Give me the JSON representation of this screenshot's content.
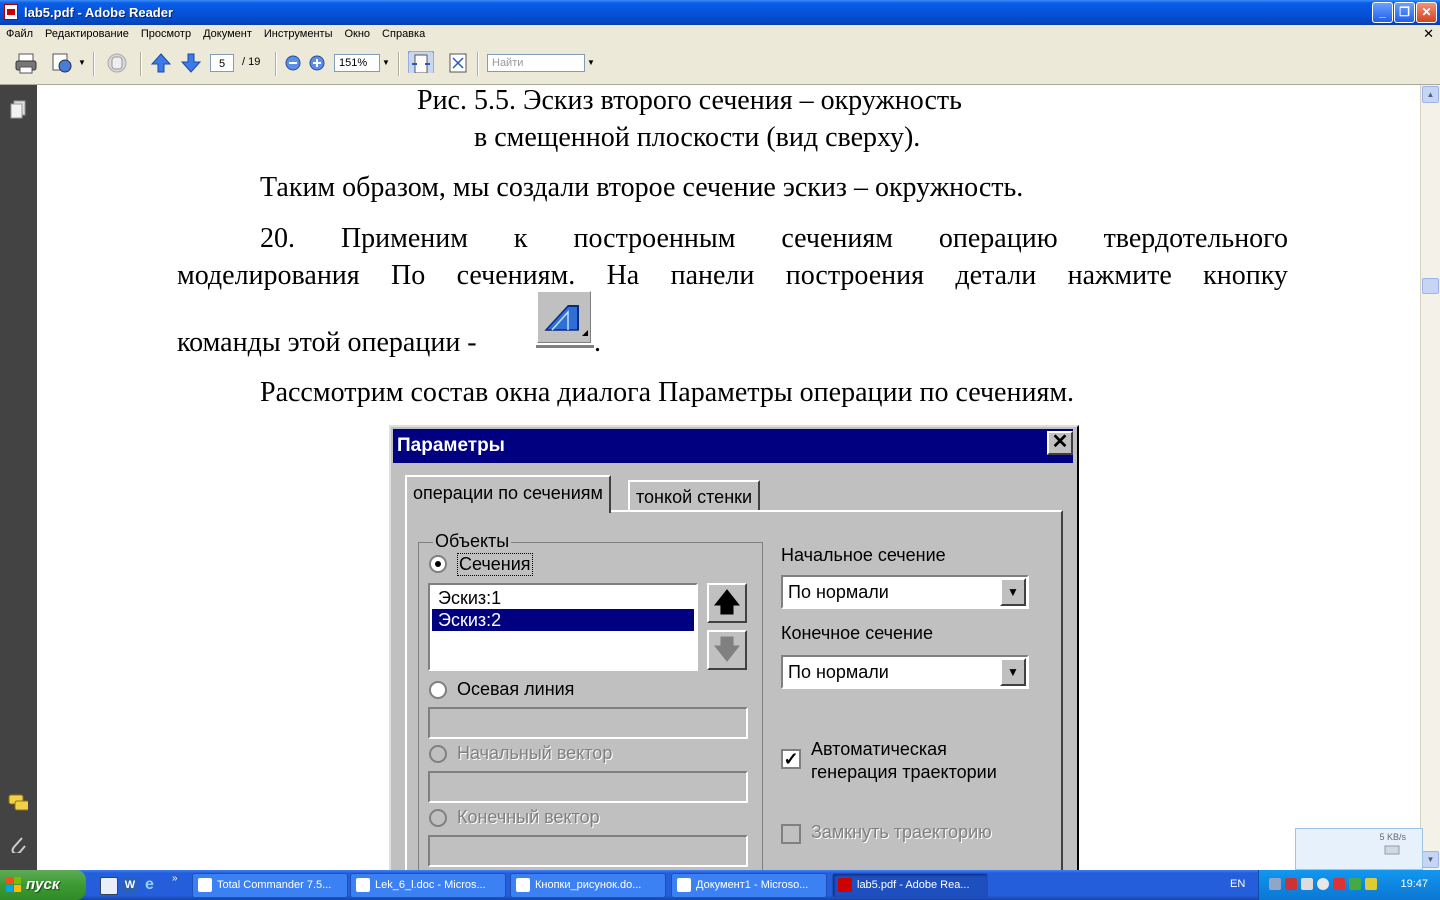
{
  "window": {
    "title": "lab5.pdf - Adobe Reader"
  },
  "menu": [
    "Файл",
    "Редактирование",
    "Просмотр",
    "Документ",
    "Инструменты",
    "Окно",
    "Справка"
  ],
  "toolbar": {
    "page_current": "5",
    "page_total": "/ 19",
    "zoom": "151%",
    "find_placeholder": "Найти"
  },
  "doc": {
    "caption_line1": "Рис. 5.5. Эскиз второго сечения – окружность",
    "caption_line2": "в смещенной плоскости (вид сверху).",
    "para1": "Таким образом, мы создали второе сечение эскиз – окружность.",
    "para2_line1": [
      "20.",
      "Применим",
      "к",
      "построенным",
      "сечениям",
      "операцию",
      "твердотельного"
    ],
    "para2_line2": [
      "моделирования",
      "По",
      "сечениям.",
      "На",
      "панели",
      "построения",
      "детали",
      "нажмите",
      "кнопку"
    ],
    "para2_line3": "команды этой операции -",
    "para2_line3_end": ".",
    "para3": "Рассмотрим состав окна диалога Параметры операции по сечениям."
  },
  "dialog": {
    "title": "Параметры",
    "tabs": [
      "операции по сечениям",
      "тонкой стенки"
    ],
    "group_label": "Объекты",
    "radio_sections": "Сечения",
    "list_items": [
      "Эскиз:1",
      "Эскиз:2"
    ],
    "radio_axis": "Осевая линия",
    "radio_start_vector": "Начальный вектор",
    "radio_end_vector": "Конечный вектор",
    "start_section_label": "Начальное сечение",
    "start_section_value": "По нормали",
    "end_section_label": "Конечное сечение",
    "end_section_value": "По нормали",
    "auto_gen_line1": "Автоматическая",
    "auto_gen_line2": "генерация траектории",
    "close_path": "Замкнуть траекторию"
  },
  "tray_popup": {
    "speed": "5 KB/s"
  },
  "taskbar": {
    "start": "пуск",
    "tasks": [
      "Total Commander 7.5...",
      "Lek_6_l.doc - Micros...",
      "Кнопки_рисунок.do...",
      "Документ1 - Microso...",
      "lab5.pdf - Adobe Rea..."
    ],
    "lang": "EN",
    "clock": "19:47"
  }
}
